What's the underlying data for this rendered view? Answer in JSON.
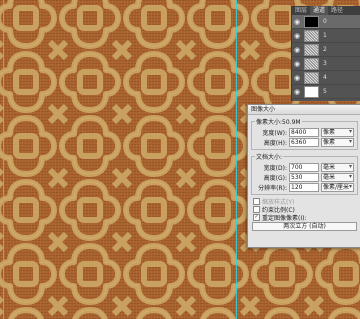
{
  "layers_panel": {
    "tabs": [
      "图层",
      "通道",
      "路径"
    ],
    "active_tab_index": 1,
    "layers": [
      {
        "name": "0",
        "thumb": "black"
      },
      {
        "name": "1",
        "thumb": "noise"
      },
      {
        "name": "2",
        "thumb": "noise"
      },
      {
        "name": "3",
        "thumb": "noise"
      },
      {
        "name": "4",
        "thumb": "noise"
      },
      {
        "name": "5",
        "thumb": "white"
      }
    ],
    "eye_icon": "eye-icon"
  },
  "dialog": {
    "title": "图像大小",
    "pixel_dimensions": {
      "legend": "像素大小:50.9M",
      "width_label": "宽度(W):",
      "width_value": "8400",
      "width_unit": "像素",
      "height_label": "高度(H):",
      "height_value": "6360",
      "height_unit": "像素"
    },
    "document_size": {
      "legend": "文档大小:",
      "width_label": "宽度(D):",
      "width_value": "700",
      "width_unit": "毫米",
      "height_label": "高度(G):",
      "height_value": "530",
      "height_unit": "毫米",
      "resolution_label": "分辨率(R):",
      "resolution_value": "120",
      "resolution_unit": "像素/厘米"
    },
    "scale_styles": {
      "label": "缩放样式(Y)",
      "checked": false,
      "disabled": true
    },
    "constrain_proportions": {
      "label": "约束比例(C)",
      "checked": false
    },
    "resample": {
      "label": "重定图像像素(I):",
      "checked": true
    },
    "resample_method": "两次立方 (自动)"
  },
  "colors": {
    "canvas_bg": "#a8622e",
    "lattice": "#c8a060",
    "guide": "#28d7e8"
  }
}
